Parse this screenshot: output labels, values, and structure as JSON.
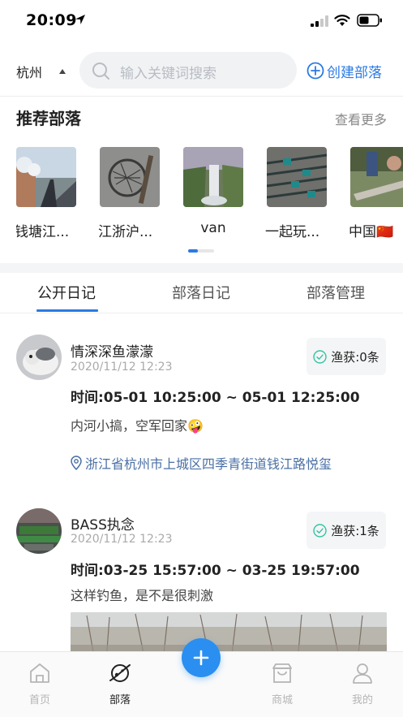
{
  "status_bar": {
    "time": "20:09"
  },
  "header": {
    "city": "杭州",
    "search_placeholder": "输入关键词搜索",
    "create_label": "创建部落"
  },
  "recommend": {
    "title": "推荐部落",
    "more_label": "查看更多",
    "items": [
      {
        "name": "钱塘江..."
      },
      {
        "name": "江浙沪..."
      },
      {
        "name": "van"
      },
      {
        "name": "一起玩..."
      },
      {
        "name": "中国🇨🇳"
      }
    ],
    "page_indicator": {
      "current": 1,
      "total": 2
    }
  },
  "tabs": [
    {
      "label": "公开日记",
      "active": true
    },
    {
      "label": "部落日记",
      "active": false
    },
    {
      "label": "部落管理",
      "active": false
    }
  ],
  "posts": [
    {
      "user": "情深深鱼濛濛",
      "date": "2020/11/12 12:23",
      "catch_label": "渔获:0条",
      "time_range": "时间:05-01 10:25:00 ~ 05-01 12:25:00",
      "text": "内河小搞，空军回家🤪",
      "location": "浙江省杭州市上城区四季青街道钱江路悦玺"
    },
    {
      "user": "BASS执念",
      "date": "2020/11/12 12:23",
      "catch_label": "渔获:1条",
      "time_range": "时间:03-25 15:57:00 ~ 03-25 19:57:00",
      "text": "这样钓鱼，是不是很刺激"
    }
  ],
  "bottom_nav": [
    {
      "label": "首页",
      "icon": "home-icon",
      "active": false
    },
    {
      "label": "部落",
      "icon": "planet-icon",
      "active": true
    },
    {
      "label": "商城",
      "icon": "shop-icon",
      "active": false
    },
    {
      "label": "我的",
      "icon": "profile-icon",
      "active": false
    }
  ],
  "colors": {
    "accent": "#2a7ae4",
    "fab": "#2a8ff0",
    "location": "#4a6fa5",
    "catch_check": "#33c4a0"
  }
}
